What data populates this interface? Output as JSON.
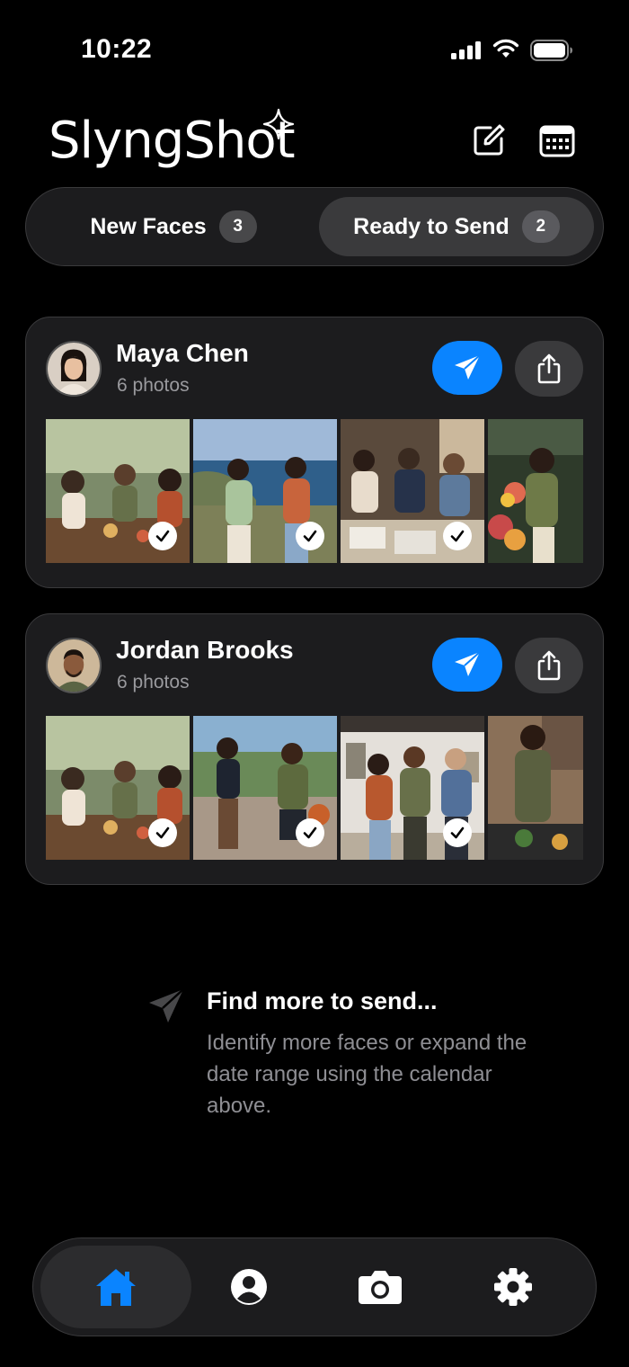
{
  "status_bar": {
    "time": "10:22"
  },
  "header": {
    "logo_text": "SlyngShot",
    "compose_icon": "compose-icon",
    "calendar_icon": "calendar-icon"
  },
  "tabs": [
    {
      "label": "New Faces",
      "count": "3",
      "active": false
    },
    {
      "label": "Ready to Send",
      "count": "2",
      "active": true
    }
  ],
  "people": [
    {
      "name": "Maya Chen",
      "photo_count": "6 photos",
      "photos": [
        {
          "scene": "outdoor-cafe-group",
          "selected": true
        },
        {
          "scene": "coastal-walk-two-women",
          "selected": true
        },
        {
          "scene": "table-planning-group",
          "selected": true
        },
        {
          "scene": "flower-market",
          "selected": false
        }
      ]
    },
    {
      "name": "Jordan Brooks",
      "photo_count": "6 photos",
      "photos": [
        {
          "scene": "outdoor-cafe-group",
          "selected": true
        },
        {
          "scene": "basketball-court",
          "selected": true
        },
        {
          "scene": "art-gallery-group",
          "selected": true
        },
        {
          "scene": "kitchen-cooking",
          "selected": false
        }
      ]
    }
  ],
  "find_more": {
    "title": "Find more to send...",
    "body": "Identify more faces or expand the date range using the calendar above."
  },
  "bottom_nav": [
    {
      "icon": "home-icon",
      "active": true,
      "color": "#0a84ff"
    },
    {
      "icon": "profile-icon",
      "active": false
    },
    {
      "icon": "camera-icon",
      "active": false
    },
    {
      "icon": "settings-icon",
      "active": false
    }
  ],
  "colors": {
    "accent": "#0a84ff",
    "card": "#1c1c1e",
    "background": "#000000"
  }
}
